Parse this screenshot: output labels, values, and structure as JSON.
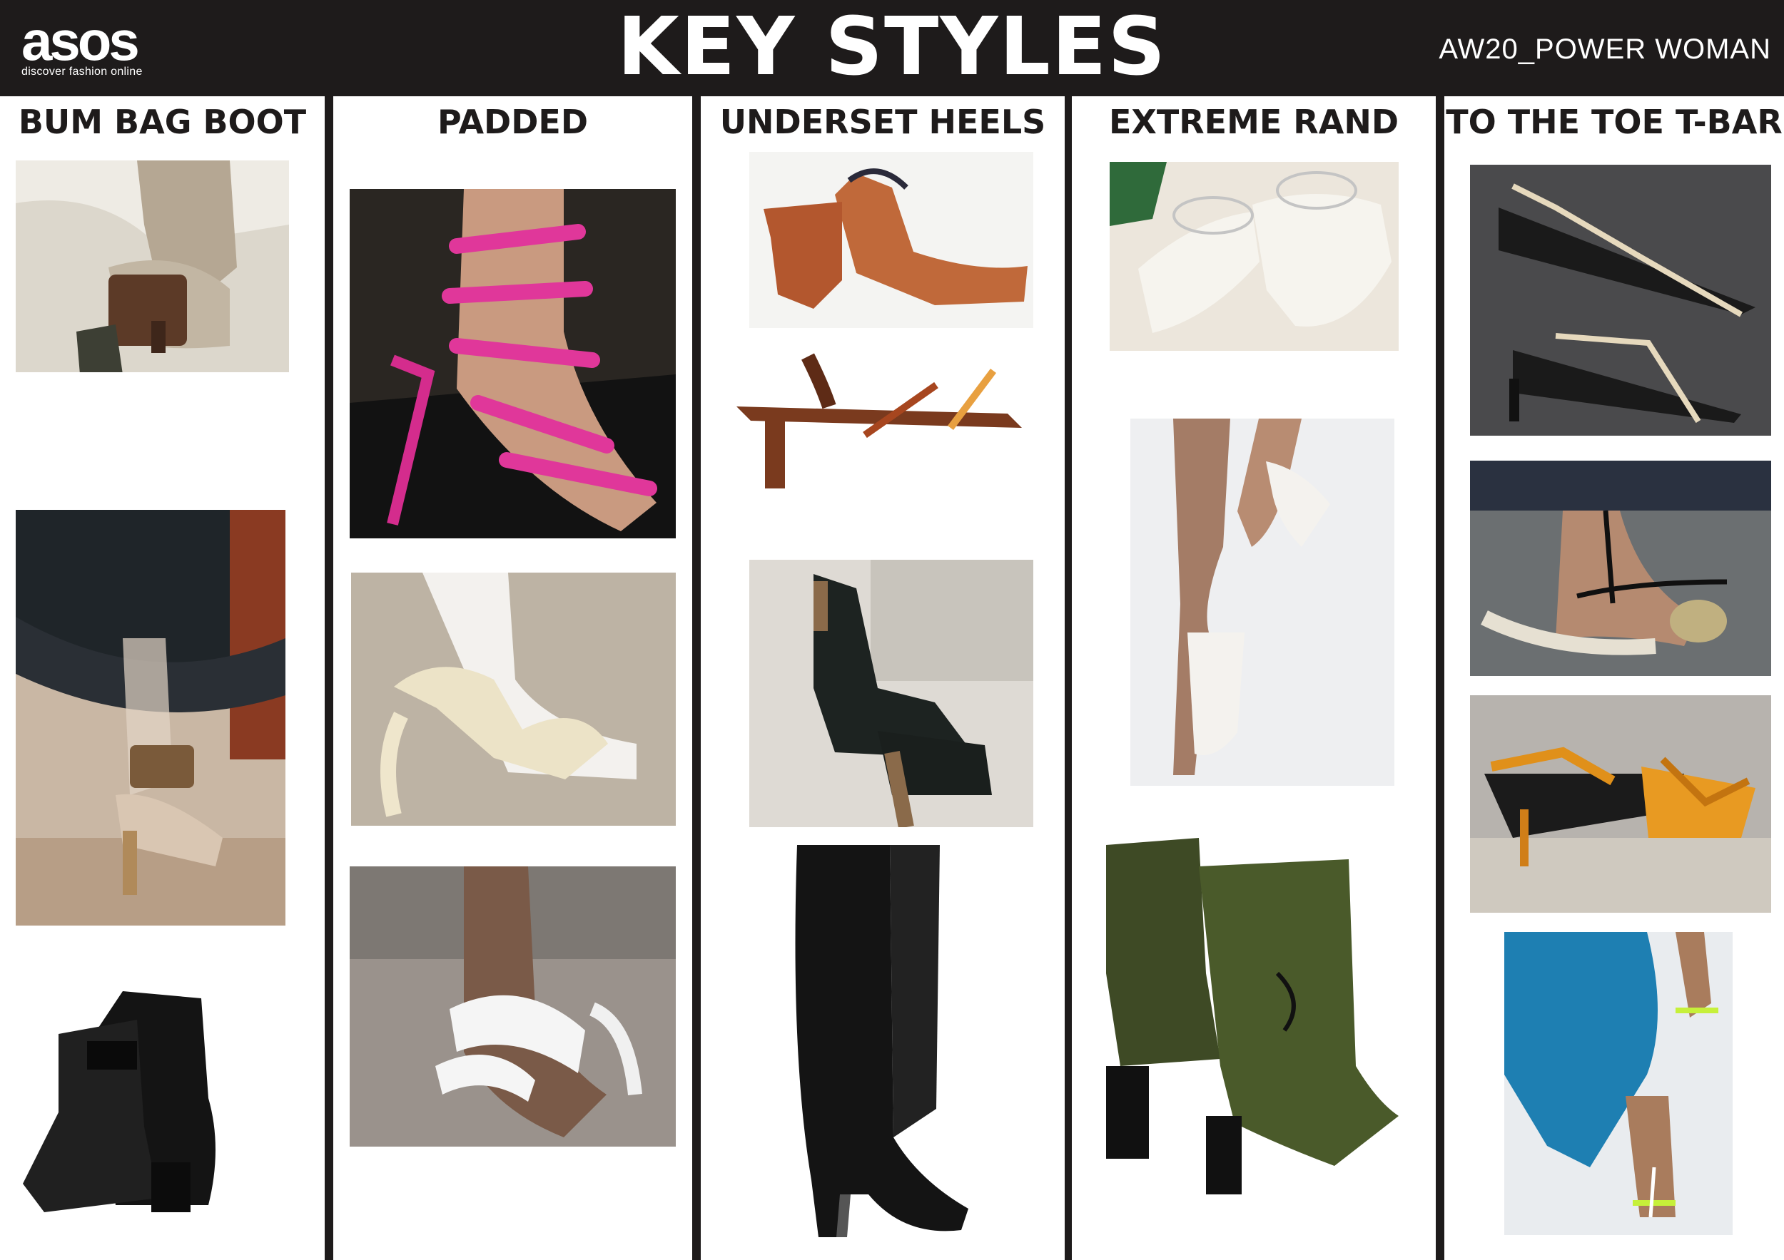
{
  "header": {
    "logo": {
      "wordmark": "asos",
      "tagline": "discover fashion online"
    },
    "title": "KEY STYLES",
    "season": "AW20_POWER WOMAN"
  },
  "columns": [
    {
      "title": "BUM BAG BOOT",
      "photos": [
        {
          "subject": "beige boot with brown leather bum bag",
          "icon": "boot-photo"
        },
        {
          "subject": "clear heeled shoe with monogram pouch",
          "icon": "shoe-photo"
        },
        {
          "subject": "black quilted lace-up ankle boots",
          "icon": "boot-photo"
        }
      ]
    },
    {
      "title": "PADDED",
      "photos": [
        {
          "subject": "pink padded strappy sandal",
          "icon": "sandal-photo"
        },
        {
          "subject": "cream padded slingback sandal",
          "icon": "sandal-photo"
        },
        {
          "subject": "white padded mule",
          "icon": "mule-photo"
        }
      ]
    },
    {
      "title": "UNDERSET HEELS",
      "photos": [
        {
          "subject": "tan square-toe slingback",
          "icon": "shoe-photo"
        },
        {
          "subject": "brown minimal strap sandal",
          "icon": "sandal-photo"
        },
        {
          "subject": "black mule with gradient heel",
          "icon": "mule-photo"
        },
        {
          "subject": "black knee-high boot",
          "icon": "boot-photo"
        }
      ]
    },
    {
      "title": "EXTREME RAND",
      "photos": [
        {
          "subject": "white studded rand flats",
          "icon": "shoe-photo"
        },
        {
          "subject": "white ankle-strap heel on runway",
          "icon": "shoe-photo"
        },
        {
          "subject": "green patent ankle boots",
          "icon": "boot-photo"
        }
      ]
    },
    {
      "title": "TO THE TOE T-BAR",
      "photos": [
        {
          "subject": "black and cream strappy kitten heel",
          "icon": "sandal-photo"
        },
        {
          "subject": "black T-bar sandal",
          "icon": "sandal-photo"
        },
        {
          "subject": "orange strappy kitten-heel mule",
          "icon": "mule-photo"
        },
        {
          "subject": "neon toe-strap sandal on runway",
          "icon": "sandal-photo"
        }
      ]
    }
  ]
}
